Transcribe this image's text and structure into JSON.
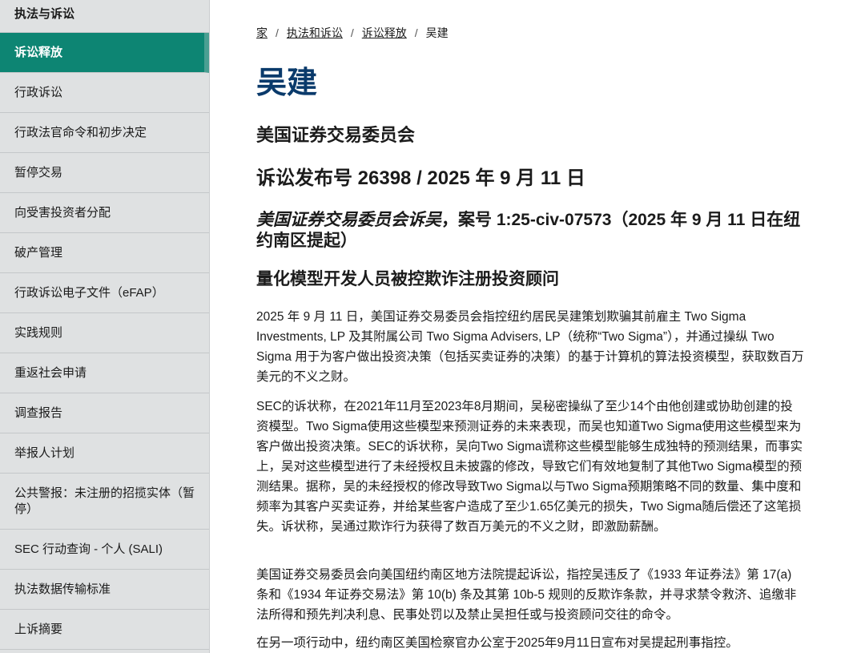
{
  "sidebar": {
    "top_label": "执法与诉讼",
    "items": [
      {
        "label": "诉讼释放",
        "active": true
      },
      {
        "label": "行政诉讼"
      },
      {
        "label": "行政法官命令和初步决定"
      },
      {
        "label": "暂停交易"
      },
      {
        "label": "向受害投资者分配"
      },
      {
        "label": "破产管理"
      },
      {
        "label": "行政诉讼电子文件（eFAP）"
      },
      {
        "label": "实践规则"
      },
      {
        "label": "重返社会申请"
      },
      {
        "label": "调查报告"
      },
      {
        "label": "举报人计划"
      },
      {
        "label": "公共警报：未注册的招揽实体（暂停）"
      },
      {
        "label": "SEC 行动查询 - 个人 (SALI)"
      },
      {
        "label": "执法数据传输标准"
      },
      {
        "label": "上诉摘要"
      }
    ]
  },
  "breadcrumb": {
    "home": "家",
    "level1": "执法和诉讼",
    "level2": "诉讼释放",
    "current": "吴建",
    "separator": "/"
  },
  "page": {
    "title": "吴建",
    "agency": "美国证券交易委员会",
    "release": "诉讼发布号 26398 / 2025 年 9 月 11 日",
    "case_italic": "美国证券交易委员会诉吴",
    "case_rest": "，案号 1:25-civ-07573（2025 年 9 月 11 日在纽约南区提起）",
    "subhead": "量化模型开发人员被控欺诈注册投资顾问",
    "paragraphs": [
      "2025 年 9 月 11 日，美国证券交易委员会指控纽约居民吴建策划欺骗其前雇主 Two Sigma Investments, LP 及其附属公司 Two Sigma Advisers, LP（统称“Two Sigma”），并通过操纵 Two Sigma 用于为客户做出投资决策（包括买卖证券的决策）的基于计算机的算法投资模型，获取数百万美元的不义之财。",
      "SEC的诉状称，在2021年11月至2023年8月期间，吴秘密操纵了至少14个由他创建或协助创建的投资模型。Two Sigma使用这些模型来预测证券的未来表现，而吴也知道Two Sigma使用这些模型来为客户做出投资决策。SEC的诉状称，吴向Two Sigma谎称这些模型能够生成独特的预测结果，而事实上，吴对这些模型进行了未经授权且未披露的修改，导致它们有效地复制了其他Two Sigma模型的预测结果。据称，吴的未经授权的修改导致Two Sigma以与Two Sigma预期策略不同的数量、集中度和频率为其客户买卖证券，并给某些客户造成了至少1.65亿美元的损失，Two Sigma随后偿还了这笔损失。诉状称，吴通过欺诈行为获得了数百万美元的不义之财，即激励薪酬。",
      "美国证券交易委员会向美国纽约南区地方法院提起诉讼，指控吴违反了《1933 年证券法》第 17(a) 条和《1934 年证券交易法》第 10(b) 条及其第 10b-5 规则的反欺诈条款，并寻求禁令救济、追缴非法所得和预先判决利息、民事处罚以及禁止吴担任或与投资顾问交往的命令。",
      "在另一项行动中，纽约南区美国检察官办公室于2025年9月11日宣布对吴提起刑事指控。"
    ]
  },
  "colors": {
    "active_bg": "#0d8573",
    "title": "#0a3a6b",
    "sidebar_bg": "#dfe1e2"
  }
}
